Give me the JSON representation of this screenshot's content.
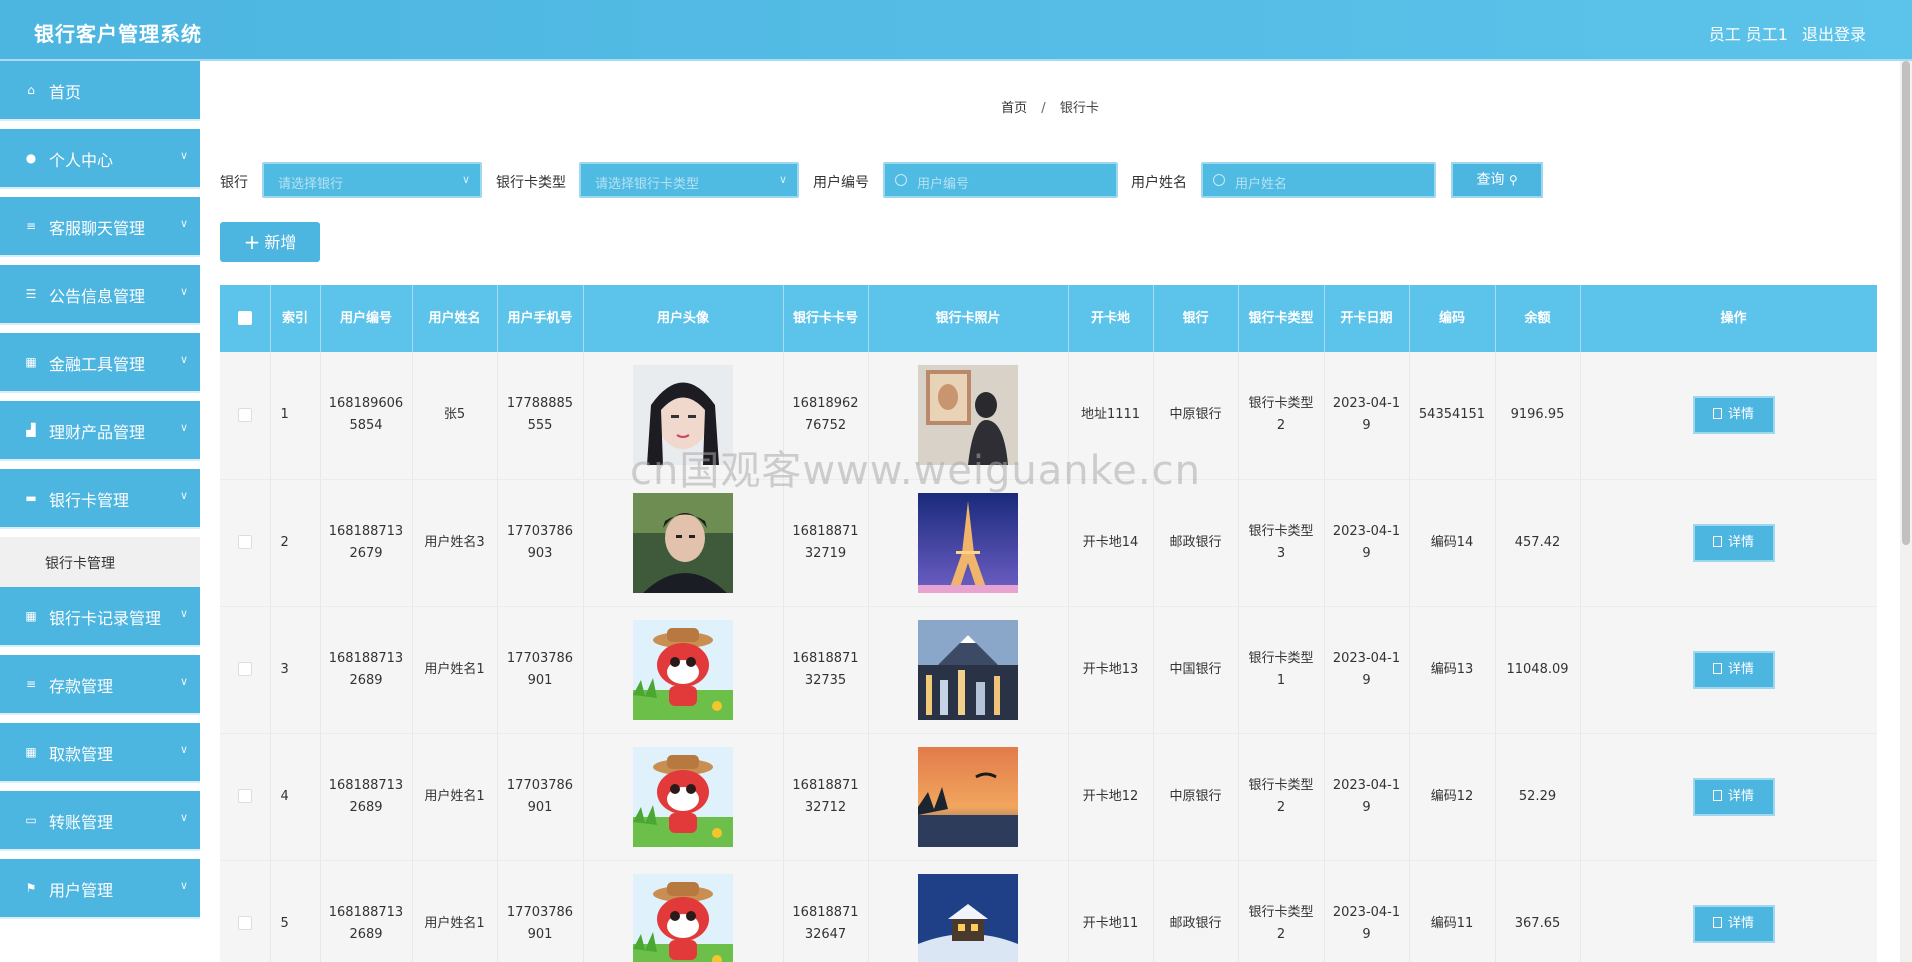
{
  "header": {
    "title": "银行客户管理系统",
    "user": "员工 员工1",
    "logout": "退出登录"
  },
  "sidebar": {
    "items": [
      {
        "label": "首页",
        "icon": "home-icon",
        "glyph": "⌂",
        "chevron": false
      },
      {
        "label": "个人中心",
        "icon": "user-icon",
        "glyph": "●",
        "chevron": true
      },
      {
        "label": "客服聊天管理",
        "icon": "menu-icon",
        "glyph": "≡",
        "chevron": true
      },
      {
        "label": "公告信息管理",
        "icon": "sliders-icon",
        "glyph": "☰",
        "chevron": true
      },
      {
        "label": "金融工具管理",
        "icon": "grid-icon",
        "glyph": "▦",
        "chevron": true
      },
      {
        "label": "理财产品管理",
        "icon": "chart-icon",
        "glyph": "▟",
        "chevron": true
      },
      {
        "label": "银行卡管理",
        "icon": "card-icon",
        "glyph": "▬",
        "chevron": true,
        "sub": "银行卡管理"
      },
      {
        "label": "银行卡记录管理",
        "icon": "grid-icon",
        "glyph": "▦",
        "chevron": true
      },
      {
        "label": "存款管理",
        "icon": "menu-icon",
        "glyph": "≡",
        "chevron": true
      },
      {
        "label": "取款管理",
        "icon": "grid-icon",
        "glyph": "▦",
        "chevron": true
      },
      {
        "label": "转账管理",
        "icon": "monitor-icon",
        "glyph": "▭",
        "chevron": true
      },
      {
        "label": "用户管理",
        "icon": "flag-icon",
        "glyph": "⚑",
        "chevron": true
      }
    ]
  },
  "breadcrumb": {
    "home": "首页",
    "separator": "/",
    "current": "银行卡"
  },
  "filters": {
    "bank_label": "银行",
    "bank_placeholder": "请选择银行",
    "card_type_label": "银行卡类型",
    "card_type_placeholder": "请选择银行卡类型",
    "user_no_label": "用户编号",
    "user_no_placeholder": "用户编号",
    "user_name_label": "用户姓名",
    "user_name_placeholder": "用户姓名",
    "query_label": "查询"
  },
  "add_button": {
    "label": "新增"
  },
  "table": {
    "headers": [
      "索引",
      "用户编号",
      "用户姓名",
      "用户手机号",
      "用户头像",
      "银行卡卡号",
      "银行卡照片",
      "开卡地",
      "银行",
      "银行卡类型",
      "开卡日期",
      "编码",
      "余额",
      "操作"
    ],
    "detail_label": "详情",
    "rows": [
      {
        "index": "1",
        "user_no": "1681896065854",
        "user_name": "张5",
        "phone": "17788885555",
        "avatar": "portrait-girl",
        "card_no": "1681896276752",
        "card_photo": "person-painting",
        "open_place": "地址1111",
        "bank": "中原银行",
        "card_type": "银行卡类型2",
        "open_date": "2023-04-19",
        "code": "54354151",
        "balance": "9196.95"
      },
      {
        "index": "2",
        "user_no": "1681887132679",
        "user_name": "用户姓名3",
        "phone": "17703786903",
        "avatar": "portrait-man",
        "card_no": "1681887132719",
        "card_photo": "eiffel-tower",
        "open_place": "开卡地14",
        "bank": "邮政银行",
        "card_type": "银行卡类型3",
        "open_date": "2023-04-19",
        "code": "编码14",
        "balance": "457.42"
      },
      {
        "index": "3",
        "user_no": "1681887132689",
        "user_name": "用户姓名1",
        "phone": "17703786901",
        "avatar": "cartoon-fox",
        "card_no": "1681887132735",
        "card_photo": "city-mountain",
        "open_place": "开卡地13",
        "bank": "中国银行",
        "card_type": "银行卡类型1",
        "open_date": "2023-04-19",
        "code": "编码13",
        "balance": "11048.09"
      },
      {
        "index": "4",
        "user_no": "1681887132689",
        "user_name": "用户姓名1",
        "phone": "17703786901",
        "avatar": "cartoon-fox",
        "card_no": "1681887132712",
        "card_photo": "sunset-lake",
        "open_place": "开卡地12",
        "bank": "中原银行",
        "card_type": "银行卡类型2",
        "open_date": "2023-04-19",
        "code": "编码12",
        "balance": "52.29"
      },
      {
        "index": "5",
        "user_no": "1681887132689",
        "user_name": "用户姓名1",
        "phone": "17703786901",
        "avatar": "cartoon-fox",
        "card_no": "1681887132647",
        "card_photo": "snow-house",
        "open_place": "开卡地11",
        "bank": "邮政银行",
        "card_type": "银行卡类型2",
        "open_date": "2023-04-19",
        "code": "编码11",
        "balance": "367.65"
      }
    ]
  },
  "watermark": "cn国观客www.weiguanke.cn",
  "colors": {
    "primary": "#4cb5e0",
    "header_cell": "#5cc3ea",
    "row_bg": "#f5f5f5"
  }
}
